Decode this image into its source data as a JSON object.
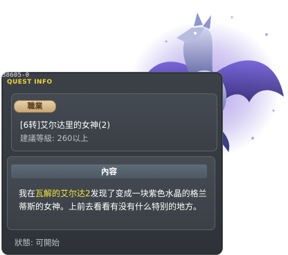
{
  "quest": {
    "id": "38605-0",
    "section_title": "QUEST INFO",
    "job_tag": "職業",
    "title": "[6转]艾尔达里的女神(2)",
    "level_label": "建議等級: 260以上",
    "content_header": "內容",
    "description_pre": "我在",
    "description_highlight": "瓦解的艾尔达2",
    "description_post": "发现了变成一块紫色水晶的格兰蒂斯的女神。上前去看看有没有什么特别的地方。",
    "status": "狀態:  可開始"
  },
  "colors": {
    "panel_bg": "#3c4148",
    "accent_yellow": "#f0d23c",
    "highlight_text": "#f3e63a",
    "job_tag_bg": "#d8bc8c",
    "dragon_purple": "#6a4fd8"
  },
  "icons": {
    "npc": "dragon-crystal-goddess"
  }
}
